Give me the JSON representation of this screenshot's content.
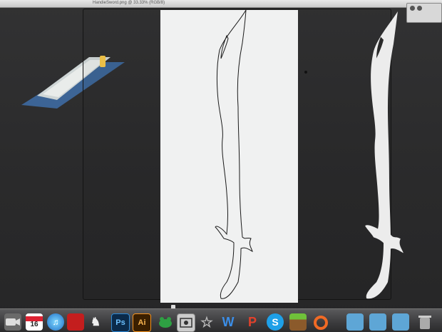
{
  "window": {
    "title": "HandieSword.png @ 33.33% (RGB/8)"
  },
  "colors": {
    "artboard": "#f0f1f1",
    "desktop": "#2b2b2c",
    "sword_stroke": "#1a1a1a",
    "sword_fill": "#ececec"
  },
  "dock": {
    "items": [
      {
        "name": "camera-icon"
      },
      {
        "name": "calendar-icon",
        "label": "16"
      },
      {
        "name": "itunes-icon"
      },
      {
        "name": "red-app-icon"
      },
      {
        "name": "unicorn-icon"
      },
      {
        "name": "photoshop-icon",
        "label": "Ps"
      },
      {
        "name": "illustrator-icon",
        "label": "Ai"
      },
      {
        "name": "frog-icon"
      },
      {
        "name": "screenshot-icon"
      },
      {
        "name": "star-icon"
      },
      {
        "name": "word-icon",
        "label": "W"
      },
      {
        "name": "wordpress-icon",
        "label": "P"
      },
      {
        "name": "skype-icon",
        "label": "S"
      },
      {
        "name": "minecraft-icon"
      },
      {
        "name": "orange-app-icon"
      },
      {
        "name": "folder-icon"
      },
      {
        "name": "folder-icon"
      },
      {
        "name": "folder-icon"
      },
      {
        "name": "trash-icon"
      }
    ]
  }
}
